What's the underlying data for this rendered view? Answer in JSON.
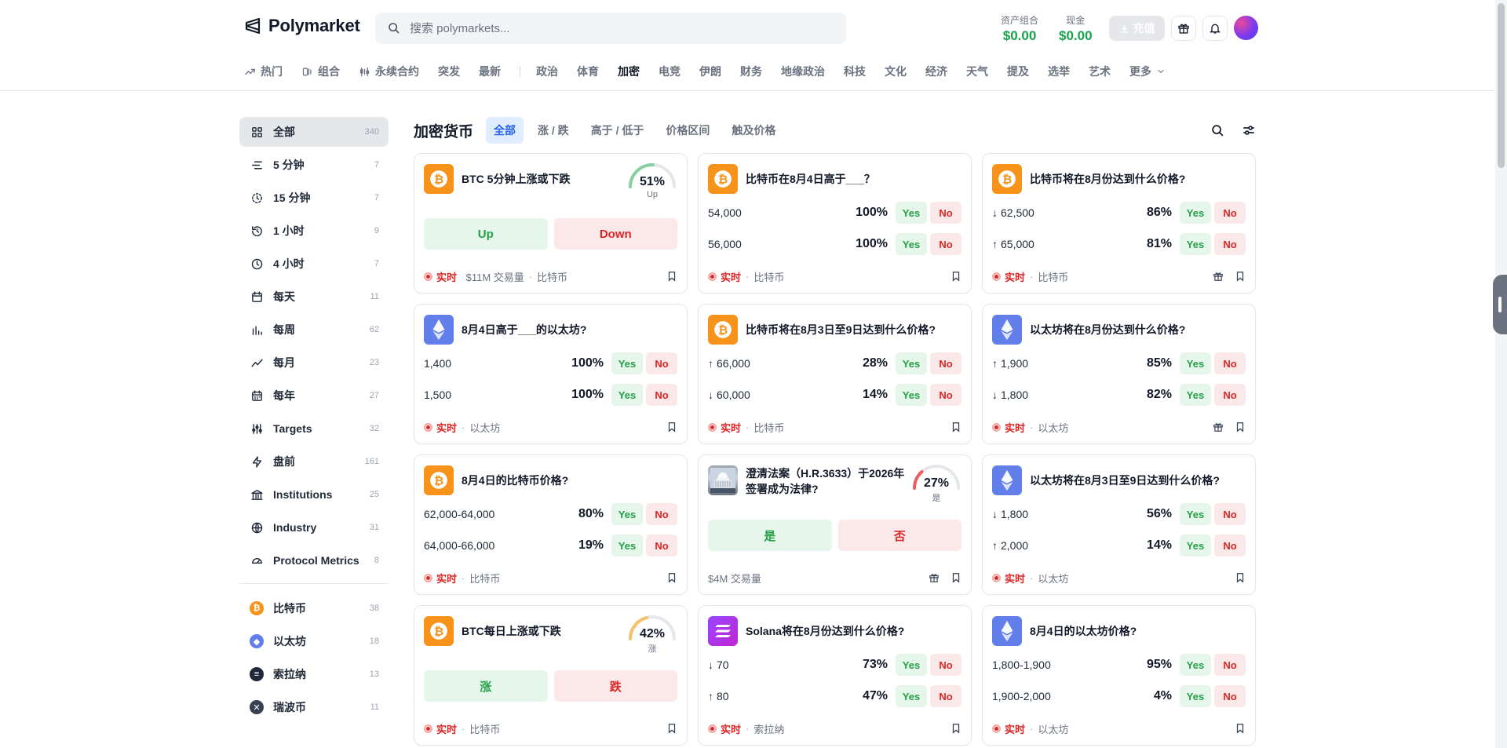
{
  "brand": {
    "name": "Polymarket"
  },
  "search": {
    "placeholder": "搜索 polymarkets..."
  },
  "account": {
    "portfolio_label": "资产组合",
    "portfolio_value": "$0.00",
    "cash_label": "现金",
    "cash_value": "$0.00",
    "deposit_label": "充值"
  },
  "nav": {
    "items": [
      {
        "label": "热门",
        "icon": "trending-icon"
      },
      {
        "label": "组合",
        "icon": "combo-icon"
      },
      {
        "label": "永续合约",
        "icon": "perpetual-icon"
      },
      {
        "label": "突发"
      },
      {
        "label": "最新"
      },
      {
        "label": "政治"
      },
      {
        "label": "体育"
      },
      {
        "label": "加密",
        "active": true
      },
      {
        "label": "电竞"
      },
      {
        "label": "伊朗"
      },
      {
        "label": "财务"
      },
      {
        "label": "地缘政治"
      },
      {
        "label": "科技"
      },
      {
        "label": "文化"
      },
      {
        "label": "经济"
      },
      {
        "label": "天气"
      },
      {
        "label": "提及"
      },
      {
        "label": "选举"
      },
      {
        "label": "艺术"
      },
      {
        "label": "更多",
        "icon": "chevron-down-icon"
      }
    ]
  },
  "sidebar": {
    "items": [
      {
        "label": "全部",
        "count": "340",
        "icon": "grid-icon",
        "active": true
      },
      {
        "label": "5 分钟",
        "count": "7",
        "icon": "lines-icon"
      },
      {
        "label": "15 分钟",
        "count": "7",
        "icon": "dashed-clock-icon"
      },
      {
        "label": "1 小时",
        "count": "9",
        "icon": "clock-rotate-icon"
      },
      {
        "label": "4 小时",
        "count": "7",
        "icon": "clock-icon"
      },
      {
        "label": "每天",
        "count": "11",
        "icon": "calendar-icon"
      },
      {
        "label": "每周",
        "count": "62",
        "icon": "bar-chart-icon"
      },
      {
        "label": "每月",
        "count": "23",
        "icon": "trend-line-icon"
      },
      {
        "label": "每年",
        "count": "27",
        "icon": "calendar-grid-icon"
      },
      {
        "label": "Targets",
        "count": "32",
        "icon": "sliders-icon"
      },
      {
        "label": "盘前",
        "count": "161",
        "icon": "bolt-icon"
      },
      {
        "label": "Institutions",
        "count": "25",
        "icon": "bank-icon"
      },
      {
        "label": "Industry",
        "count": "31",
        "icon": "globe-icon"
      },
      {
        "label": "Protocol Metrics",
        "count": "8",
        "icon": "gauge-icon"
      }
    ],
    "coins": [
      {
        "label": "比特币",
        "count": "38",
        "color": "#f7931a",
        "glyph": "₿"
      },
      {
        "label": "以太坊",
        "count": "18",
        "color": "#627eea",
        "glyph": "◆"
      },
      {
        "label": "索拉纳",
        "count": "13",
        "color": "#1f2937",
        "glyph": "≡"
      },
      {
        "label": "瑞波币",
        "count": "11",
        "color": "#374151",
        "glyph": "✕"
      }
    ]
  },
  "content": {
    "title": "加密货币",
    "filters": [
      {
        "label": "全部",
        "active": true
      },
      {
        "label": "涨 / 跌"
      },
      {
        "label": "高于 / 低于"
      },
      {
        "label": "价格区间"
      },
      {
        "label": "触及价格"
      }
    ]
  },
  "colors": {
    "yes": "#22a146",
    "no": "#dc2626",
    "live": "#dc2626",
    "accent": "#2563eb"
  },
  "cards": [
    {
      "type": "updown",
      "thumb": "btc",
      "title": "BTC 5分钟上涨或下跌",
      "gauge_pct": "51%",
      "gauge_label": "Up",
      "gauge_value": 51,
      "gauge_color": "#86cfa0",
      "up_label": "Up",
      "down_label": "Down",
      "live": "实时",
      "volume": "$11M 交易量",
      "tag": "比特币",
      "gift": false
    },
    {
      "type": "binary",
      "thumb": "btc",
      "title": "比特币在8月4日高于___？",
      "rows": [
        {
          "label": "54,000",
          "pct": "100%"
        },
        {
          "label": "56,000",
          "pct": "100%"
        }
      ],
      "live": "实时",
      "tag": "比特币",
      "gift": false
    },
    {
      "type": "binary",
      "thumb": "btc",
      "title": "比特币将在8月份达到什么价格?",
      "rows": [
        {
          "arrow": "↓",
          "label": "62,500",
          "pct": "86%"
        },
        {
          "arrow": "↑",
          "label": "65,000",
          "pct": "81%"
        }
      ],
      "live": "实时",
      "tag": "比特币",
      "gift": true
    },
    {
      "type": "binary",
      "thumb": "eth",
      "title": "8月4日高于___的以太坊?",
      "rows": [
        {
          "label": "1,400",
          "pct": "100%"
        },
        {
          "label": "1,500",
          "pct": "100%"
        }
      ],
      "live": "实时",
      "tag": "以太坊",
      "gift": false
    },
    {
      "type": "binary",
      "thumb": "btc",
      "title": "比特币将在8月3日至9日达到什么价格?",
      "rows": [
        {
          "arrow": "↑",
          "label": "66,000",
          "pct": "28%"
        },
        {
          "arrow": "↓",
          "label": "60,000",
          "pct": "14%"
        }
      ],
      "live": "实时",
      "tag": "比特币",
      "gift": false
    },
    {
      "type": "binary",
      "thumb": "eth",
      "title": "以太坊将在8月份达到什么价格?",
      "rows": [
        {
          "arrow": "↑",
          "label": "1,900",
          "pct": "85%"
        },
        {
          "arrow": "↓",
          "label": "1,800",
          "pct": "82%"
        }
      ],
      "live": "实时",
      "tag": "以太坊",
      "gift": true
    },
    {
      "type": "binary",
      "thumb": "btc",
      "title": "8月4日的比特币价格?",
      "rows": [
        {
          "label": "62,000-64,000",
          "pct": "80%"
        },
        {
          "label": "64,000-66,000",
          "pct": "19%"
        }
      ],
      "live": "实时",
      "tag": "比特币",
      "gift": false
    },
    {
      "type": "updown",
      "thumb": "cap",
      "title": "澄清法案（H.R.3633）于2026年签署成为法律?",
      "gauge_pct": "27%",
      "gauge_label": "是",
      "gauge_value": 27,
      "gauge_color": "#ef5a5a",
      "up_label": "是",
      "down_label": "否",
      "live": "",
      "volume": "$4M 交易量",
      "tag": "",
      "gift": true
    },
    {
      "type": "binary",
      "thumb": "eth",
      "title": "以太坊将在8月3日至9日达到什么价格?",
      "rows": [
        {
          "arrow": "↓",
          "label": "1,800",
          "pct": "56%"
        },
        {
          "arrow": "↑",
          "label": "2,000",
          "pct": "14%"
        }
      ],
      "live": "实时",
      "tag": "以太坊",
      "gift": false
    },
    {
      "type": "updown",
      "thumb": "btc",
      "title": "BTC每日上涨或下跌",
      "gauge_pct": "42%",
      "gauge_label": "涨",
      "gauge_value": 42,
      "gauge_color": "#f5c26b",
      "up_label": "涨",
      "down_label": "跌",
      "live": "实时",
      "volume": "",
      "tag": "比特币",
      "gift": false
    },
    {
      "type": "binary",
      "thumb": "sol",
      "title": "Solana将在8月份达到什么价格?",
      "rows": [
        {
          "arrow": "↓",
          "label": "70",
          "pct": "73%"
        },
        {
          "arrow": "↑",
          "label": "80",
          "pct": "47%"
        }
      ],
      "live": "实时",
      "tag": "索拉纳",
      "gift": false
    },
    {
      "type": "binary",
      "thumb": "eth",
      "title": "8月4日的以太坊价格?",
      "rows": [
        {
          "label": "1,800-1,900",
          "pct": "95%"
        },
        {
          "label": "1,900-2,000",
          "pct": "4%"
        }
      ],
      "live": "实时",
      "tag": "以太坊",
      "gift": false
    }
  ],
  "buttons": {
    "yes": "Yes",
    "no": "No"
  }
}
